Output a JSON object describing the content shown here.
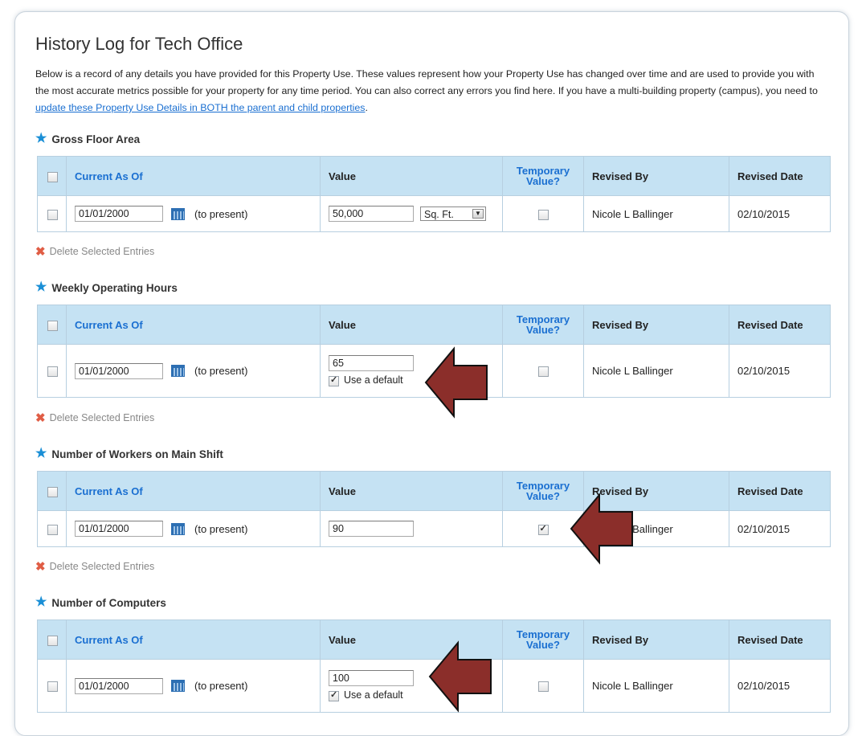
{
  "page": {
    "title": "History Log for Tech Office",
    "intro_text": "Below is a record of any details you have provided for this Property Use. These values represent how your Property Use has changed over time and are used to provide you with the most accurate metrics possible for your property for any time period. You can also correct any errors you find here. If you have a multi-building property (campus), you need to ",
    "intro_link": "update these Property Use Details in BOTH the parent and child properties",
    "intro_end": "."
  },
  "columns": {
    "current_as_of": "Current As Of",
    "value": "Value",
    "temporary_value": "Temporary Value?",
    "revised_by": "Revised By",
    "revised_date": "Revised Date"
  },
  "delete_label": "Delete Selected Entries",
  "sections": [
    {
      "title": "Gross Floor Area",
      "row": {
        "date": "01/01/2000",
        "present": "(to present)",
        "value": "50,000",
        "unit": "Sq. Ft.",
        "temporary": false,
        "revised_by": "Nicole L Ballinger",
        "revised_date": "02/10/2015"
      }
    },
    {
      "title": "Weekly Operating Hours",
      "row": {
        "date": "01/01/2000",
        "present": "(to present)",
        "value": "65",
        "use_default": "Use a default",
        "temporary": false,
        "revised_by": "Nicole L Ballinger",
        "revised_date": "02/10/2015"
      }
    },
    {
      "title": "Number of Workers on Main Shift",
      "row": {
        "date": "01/01/2000",
        "present": "(to present)",
        "value": "90",
        "temporary": true,
        "revised_by": "Nicole L Ballinger",
        "revised_date": "02/10/2015"
      }
    },
    {
      "title": "Number of Computers",
      "row": {
        "date": "01/01/2000",
        "present": "(to present)",
        "value": "100",
        "use_default": "Use a default",
        "temporary": false,
        "revised_by": "Nicole L Ballinger",
        "revised_date": "02/10/2015"
      }
    }
  ],
  "colors": {
    "accent": "#1a6fd1",
    "header_bg": "#c5e2f3",
    "arrow": "#8b2e2a"
  }
}
